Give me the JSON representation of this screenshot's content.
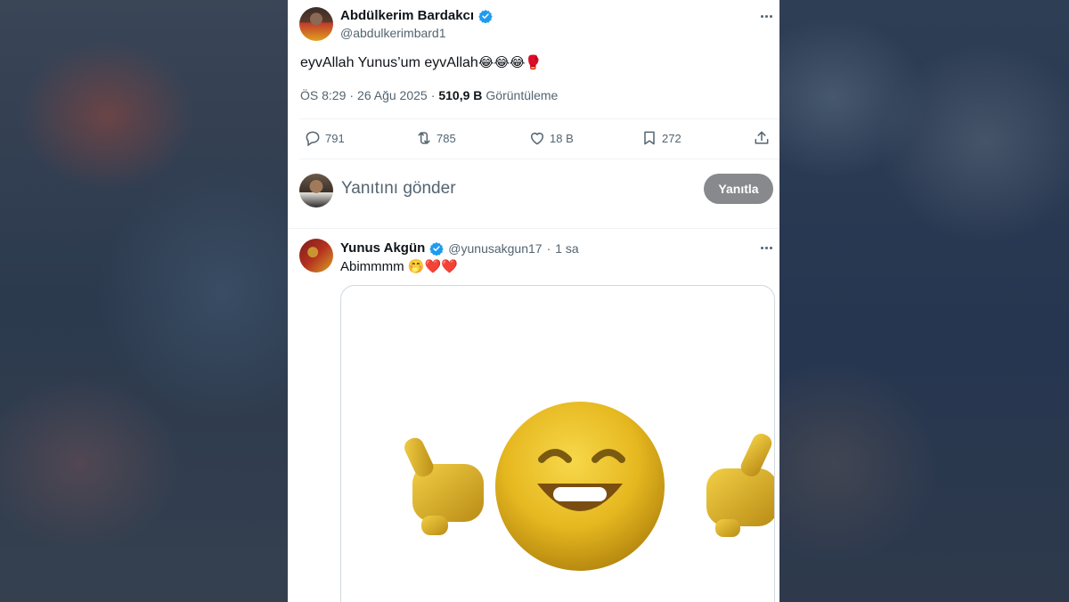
{
  "tweet": {
    "author_name": "Abdülkerim Bardakcı",
    "author_handle": "@abdulkerimbard1",
    "text": "eyvAllah Yunus’um eyvAllah",
    "text_emojis": "😂😂😂🥊",
    "time": "ÖS 8:29",
    "separator": "·",
    "date": "26 Ağu 2025",
    "views_count": "510,9 B",
    "views_label": "Görüntüleme",
    "actions": {
      "replies": "791",
      "retweets": "785",
      "likes": "18 B",
      "bookmarks": "272"
    }
  },
  "compose": {
    "placeholder": "Yanıtını gönder",
    "button_label": "Yanıtla"
  },
  "reply": {
    "author_name": "Yunus Akgün",
    "author_handle": "@yunusakgun17",
    "separator": "·",
    "time": "1 sa",
    "text": "Abimmmm",
    "text_emojis": "🤭❤️❤️"
  },
  "colors": {
    "verified": "#1d9bf0",
    "secondary_text": "#536471",
    "button_disabled": "#87898c",
    "emoji_yellow": "#f0c020"
  },
  "icons": [
    "verified-badge-icon",
    "more-icon",
    "reply-icon",
    "retweet-icon",
    "like-icon",
    "bookmark-icon",
    "share-icon"
  ]
}
